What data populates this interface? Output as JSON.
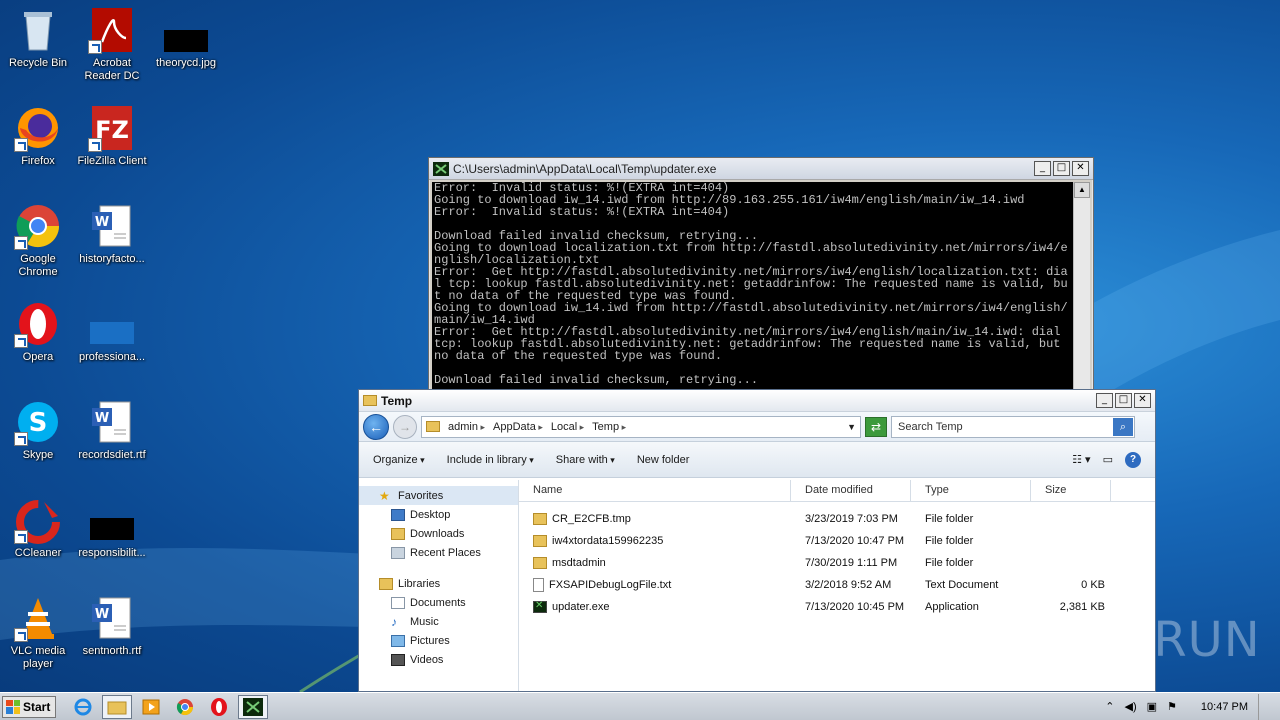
{
  "desktop": {
    "icons": [
      {
        "label": "Recycle Bin"
      },
      {
        "label": "Acrobat Reader DC"
      },
      {
        "label": "theorycd.jpg"
      },
      {
        "label": "Firefox"
      },
      {
        "label": "FileZilla Client"
      },
      {
        "label": "Google Chrome"
      },
      {
        "label": "historyfacto..."
      },
      {
        "label": "Opera"
      },
      {
        "label": "professiona..."
      },
      {
        "label": "Skype"
      },
      {
        "label": "recordsdiet.rtf"
      },
      {
        "label": "CCleaner"
      },
      {
        "label": "responsibilit..."
      },
      {
        "label": "VLC media player"
      },
      {
        "label": "sentnorth.rtf"
      }
    ]
  },
  "console": {
    "title": "C:\\Users\\admin\\AppData\\Local\\Temp\\updater.exe",
    "output": "Error:  Invalid status: %!(EXTRA int=404)\nGoing to download iw_14.iwd from http://89.163.255.161/iw4m/english/main/iw_14.iwd\nError:  Invalid status: %!(EXTRA int=404)\n\nDownload failed invalid checksum, retrying...\nGoing to download localization.txt from http://fastdl.absolutedivinity.net/mirrors/iw4/english/localization.txt\nError:  Get http://fastdl.absolutedivinity.net/mirrors/iw4/english/localization.txt: dial tcp: lookup fastdl.absolutedivinity.net: getaddrinfow: The requested name is valid, but no data of the requested type was found.\nGoing to download iw_14.iwd from http://fastdl.absolutedivinity.net/mirrors/iw4/english/main/iw_14.iwd\nError:  Get http://fastdl.absolutedivinity.net/mirrors/iw4/english/main/iw_14.iwd: dial tcp: lookup fastdl.absolutedivinity.net: getaddrinfow: The requested name is valid, but no data of the requested type was found.\n\nDownload failed invalid checksum, retrying..."
  },
  "explorer": {
    "title": "Temp",
    "breadcrumb": [
      "admin",
      "AppData",
      "Local",
      "Temp"
    ],
    "search_placeholder": "Search Temp",
    "toolbar": {
      "organize": "Organize",
      "include_in_library": "Include in library",
      "share_with": "Share with",
      "new_folder": "New folder"
    },
    "nav": {
      "favorites": "Favorites",
      "desktop": "Desktop",
      "downloads": "Downloads",
      "recent_places": "Recent Places",
      "libraries": "Libraries",
      "documents": "Documents",
      "music": "Music",
      "pictures": "Pictures",
      "videos": "Videos"
    },
    "columns": {
      "name": "Name",
      "date": "Date modified",
      "type": "Type",
      "size": "Size"
    },
    "files": [
      {
        "name": "CR_E2CFB.tmp",
        "date": "3/23/2019 7:03 PM",
        "type": "File folder",
        "size": "",
        "icon": "folder-icon"
      },
      {
        "name": "iw4xtordata159962235",
        "date": "7/13/2020 10:47 PM",
        "type": "File folder",
        "size": "",
        "icon": "folder-icon"
      },
      {
        "name": "msdtadmin",
        "date": "7/30/2019 1:11 PM",
        "type": "File folder",
        "size": "",
        "icon": "folder-icon"
      },
      {
        "name": "FXSAPIDebugLogFile.txt",
        "date": "3/2/2018 9:52 AM",
        "type": "Text Document",
        "size": "0 KB",
        "icon": "text-file-icon"
      },
      {
        "name": "updater.exe",
        "date": "7/13/2020 10:45 PM",
        "type": "Application",
        "size": "2,381 KB",
        "icon": "exe-icon"
      }
    ]
  },
  "taskbar": {
    "start_label": "Start",
    "clock": "10:47 PM"
  },
  "watermark": "ANY RUN"
}
